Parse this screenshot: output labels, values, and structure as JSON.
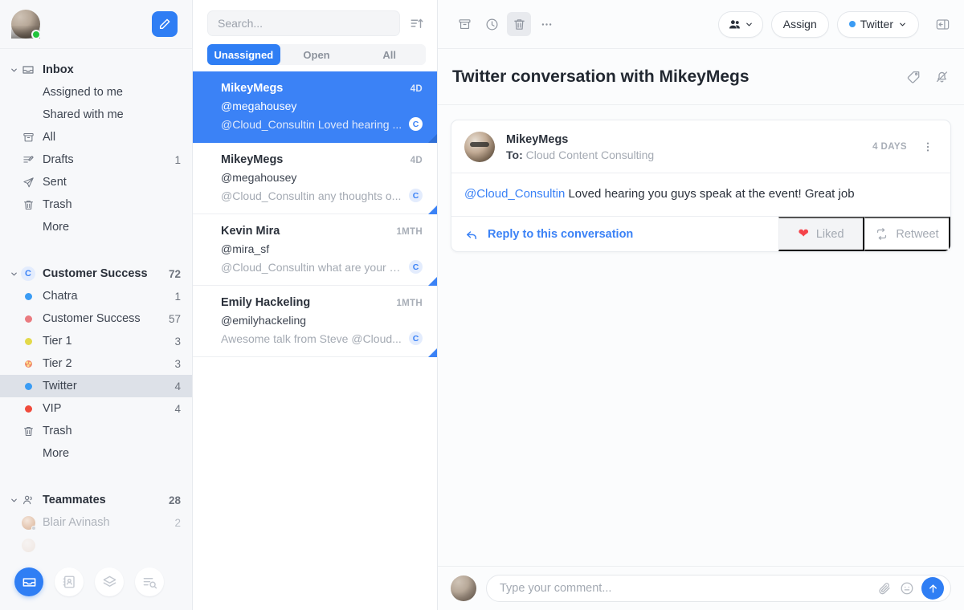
{
  "sidebar": {
    "user": {
      "status": "online"
    },
    "compose_label": "Compose",
    "groups": [
      {
        "name": "inbox-group",
        "header": {
          "label": "Inbox",
          "icon": "inbox-icon",
          "count": ""
        },
        "items": [
          {
            "label": "Assigned to me",
            "icon": "",
            "count": ""
          },
          {
            "label": "Shared with me",
            "icon": "",
            "count": ""
          },
          {
            "label": "All",
            "icon": "archive-icon",
            "count": ""
          },
          {
            "label": "Drafts",
            "icon": "draft-icon",
            "count": "1"
          },
          {
            "label": "Sent",
            "icon": "send-icon",
            "count": ""
          },
          {
            "label": "Trash",
            "icon": "trash-icon",
            "count": ""
          },
          {
            "label": "More",
            "icon": "",
            "count": ""
          }
        ]
      },
      {
        "name": "customer-success-group",
        "header": {
          "label": "Customer Success",
          "icon": "cs-badge-icon",
          "count": "72"
        },
        "items": [
          {
            "label": "Chatra",
            "icon": "dot-icon",
            "color": "#3b9cf4",
            "count": "1"
          },
          {
            "label": "Customer Success",
            "icon": "dot-icon",
            "color": "#ea7b80",
            "count": "57"
          },
          {
            "label": "Tier 1",
            "icon": "dot-icon",
            "color": "#e3d94a",
            "count": "3"
          },
          {
            "label": "Tier 2",
            "icon": "dot-pattern-icon",
            "color": "#ef8a6e",
            "count": "3"
          },
          {
            "label": "Twitter",
            "icon": "dot-icon",
            "color": "#3b9cf4",
            "count": "4",
            "selected": true
          },
          {
            "label": "VIP",
            "icon": "dot-icon",
            "color": "#f04b3c",
            "count": "4"
          },
          {
            "label": "Trash",
            "icon": "trash-icon",
            "count": ""
          },
          {
            "label": "More",
            "icon": "",
            "count": ""
          }
        ]
      },
      {
        "name": "teammates-group",
        "header": {
          "label": "Teammates",
          "icon": "people-icon",
          "count": "28"
        },
        "items": [
          {
            "label": "Blair Avinash",
            "icon": "teammate-avatar",
            "count": "2",
            "muted": true
          }
        ]
      }
    ],
    "bottom_nav": [
      {
        "name": "inbox-nav-icon",
        "active": true
      },
      {
        "name": "contacts-nav-icon",
        "active": false
      },
      {
        "name": "layers-nav-icon",
        "active": false
      },
      {
        "name": "reports-nav-icon",
        "active": false
      }
    ]
  },
  "list": {
    "search": {
      "placeholder": "Search...",
      "value": ""
    },
    "sort_icon": "sort-ascending-icon",
    "tabs": [
      {
        "label": "Unassigned",
        "active": true
      },
      {
        "label": "Open",
        "active": false
      },
      {
        "label": "All",
        "active": false
      }
    ],
    "conversations": [
      {
        "name": "MikeyMegs",
        "handle": "@megahousey",
        "snippet": "@Cloud_Consultin Loved hearing ...",
        "time": "4D",
        "badge": "C",
        "selected": true
      },
      {
        "name": "MikeyMegs",
        "handle": "@megahousey",
        "snippet": "@Cloud_Consultin any thoughts o...",
        "time": "4D",
        "badge": "C",
        "selected": false
      },
      {
        "name": "Kevin Mira",
        "handle": "@mira_sf",
        "snippet": "@Cloud_Consultin what are your p...",
        "time": "1MTH",
        "badge": "C",
        "selected": false
      },
      {
        "name": "Emily Hackeling",
        "handle": "@emilyhackeling",
        "snippet": "Awesome talk from Steve @Cloud...",
        "time": "1MTH",
        "badge": "C",
        "selected": false
      }
    ]
  },
  "main": {
    "toolbar": {
      "archive_icon": "archive-icon",
      "snooze_icon": "clock-icon",
      "delete_icon": "trash-icon",
      "more_icon": "ellipsis-icon",
      "assignee_icon": "people-icon",
      "assign_label": "Assign",
      "channel_label": "Twitter",
      "channel_color": "#3b9cf4",
      "panel_toggle_icon": "collapse-panel-icon"
    },
    "conversation": {
      "title": "Twitter conversation with MikeyMegs",
      "tag_icon": "tag-icon",
      "mute_icon": "bell-muted-icon"
    },
    "message": {
      "author": "MikeyMegs",
      "to_label": "To:",
      "to_value": "Cloud Content Consulting",
      "age": "4 DAYS",
      "kebab_icon": "kebab-menu-icon",
      "body_mention": "@Cloud_Consultin",
      "body_text": " Loved hearing you guys speak at the event! Great job",
      "reply_label": "Reply to this conversation",
      "like_label": "Liked",
      "like_active": true,
      "retweet_label": "Retweet"
    },
    "composer": {
      "placeholder": "Type your comment...",
      "value": "",
      "attach_icon": "paperclip-icon",
      "emoji_icon": "emoji-icon",
      "send_icon": "send-arrow-icon"
    }
  }
}
